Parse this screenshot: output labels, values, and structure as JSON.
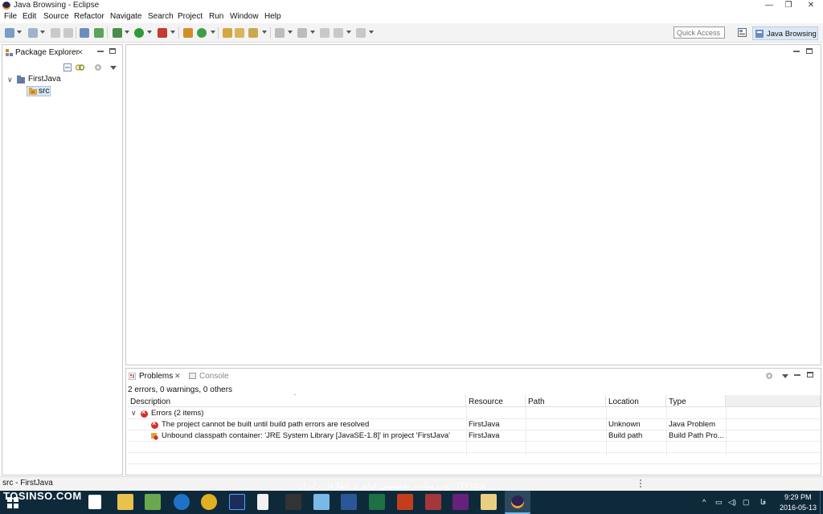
{
  "window": {
    "title": "Java Browsing - Eclipse"
  },
  "menu": [
    "File",
    "Edit",
    "Source",
    "Refactor",
    "Navigate",
    "Search",
    "Project",
    "Run",
    "Window",
    "Help"
  ],
  "toolbar": {
    "quick_access_placeholder": "Quick Access",
    "perspective_label": "Java Browsing"
  },
  "package_explorer": {
    "tab_label": "Package Explorer",
    "tree": [
      {
        "label": "FirstJava",
        "expanded": true,
        "icon": "java-project-icon"
      },
      {
        "label": "src",
        "icon": "package-folder-icon",
        "selected": true
      }
    ]
  },
  "problems": {
    "tab_label": "Problems",
    "console_tab_label": "Console",
    "summary": "2 errors, 0 warnings, 0 others",
    "columns": [
      "Description",
      "Resource",
      "Path",
      "Location",
      "Type"
    ],
    "group_label": "Errors (2 items)",
    "rows": [
      {
        "description": "The project cannot be built until build path errors are resolved",
        "resource": "FirstJava",
        "path": "",
        "location": "Unknown",
        "type": "Java Problem"
      },
      {
        "description": "Unbound classpath container: 'JRE System Library [JavaSE-1.8]' in project 'FirstJava'",
        "resource": "FirstJava",
        "path": "",
        "location": "Build path",
        "type": "Build Path Pro..."
      }
    ]
  },
  "status": {
    "text": "src - FirstJava"
  },
  "taskbar": {
    "watermark": "TOSINSO.COM",
    "watermark_fa": "وب سایت تخصصی فناوری اطلاعات ایران - ITPro.ir",
    "time": "9:29 PM",
    "date": "2016-05-13",
    "lang": "فا"
  },
  "colors": {
    "accent": "#3a6ea5",
    "error": "#d2302a",
    "taskbar": "#0e2a3a"
  }
}
